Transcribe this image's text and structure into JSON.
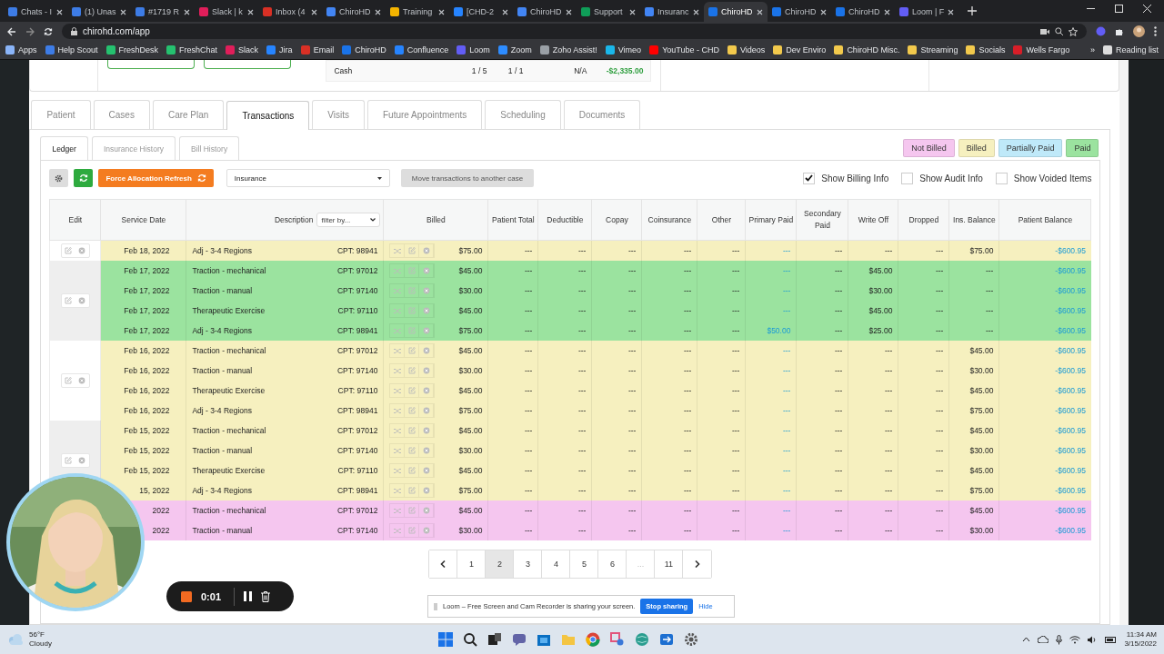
{
  "browser": {
    "tabs": [
      {
        "title": "Chats - I",
        "color": "#3d7ce6",
        "selected": false
      },
      {
        "title": "(1) Unas",
        "color": "#3d7ce6",
        "selected": false
      },
      {
        "title": "#1719 R",
        "color": "#3d7ce6",
        "selected": false
      },
      {
        "title": "Slack | k",
        "color": "#e01e5a",
        "selected": false
      },
      {
        "title": "Inbox (4",
        "color": "#d93025",
        "selected": false
      },
      {
        "title": "ChiroHD",
        "color": "#4285f4",
        "selected": false
      },
      {
        "title": "Training",
        "color": "#f4b400",
        "selected": false
      },
      {
        "title": "[CHD-2",
        "color": "#2684ff",
        "selected": false
      },
      {
        "title": "ChiroHD",
        "color": "#4285f4",
        "selected": false
      },
      {
        "title": "Support",
        "color": "#0f9d58",
        "selected": false
      },
      {
        "title": "Insuranc",
        "color": "#4285f4",
        "selected": false
      },
      {
        "title": "ChiroHD",
        "color": "#1a73e8",
        "selected": true
      },
      {
        "title": "ChiroHD",
        "color": "#1a73e8",
        "selected": false
      },
      {
        "title": "ChiroHD",
        "color": "#1a73e8",
        "selected": false
      },
      {
        "title": "Loom | F",
        "color": "#625df5",
        "selected": false
      }
    ],
    "url": "chirohd.com/app",
    "bookmarks": [
      {
        "label": "Apps",
        "color": "#8ab4f8"
      },
      {
        "label": "Help Scout",
        "color": "#3d7ce6"
      },
      {
        "label": "FreshDesk",
        "color": "#25c16f"
      },
      {
        "label": "FreshChat",
        "color": "#25c16f"
      },
      {
        "label": "Slack",
        "color": "#e01e5a"
      },
      {
        "label": "Jira",
        "color": "#2684ff"
      },
      {
        "label": "Email",
        "color": "#d93025"
      },
      {
        "label": "ChiroHD",
        "color": "#1a73e8"
      },
      {
        "label": "Confluence",
        "color": "#2684ff"
      },
      {
        "label": "Loom",
        "color": "#625df5"
      },
      {
        "label": "Zoom",
        "color": "#2d8cff"
      },
      {
        "label": "Zoho Assist!",
        "color": "#9aa0a6"
      },
      {
        "label": "Vimeo",
        "color": "#1ab7ea"
      },
      {
        "label": "YouTube - CHD",
        "color": "#ff0000"
      },
      {
        "label": "Videos",
        "color": "#f2c94c"
      },
      {
        "label": "Dev Enviro",
        "color": "#f2c94c"
      },
      {
        "label": "ChiroHD Misc.",
        "color": "#f2c94c"
      },
      {
        "label": "Streaming",
        "color": "#f2c94c"
      },
      {
        "label": "Socials",
        "color": "#f2c94c"
      },
      {
        "label": "Wells Fargo",
        "color": "#d71e28"
      }
    ],
    "bookmarks_more": "»",
    "reading_list": "Reading list"
  },
  "summary": {
    "payer": "Cash",
    "column_2": "1 / 5",
    "column_3": "1 / 1",
    "column_4": "N/A",
    "amount": "-$2,335.00"
  },
  "tabs": [
    {
      "label": "Patient",
      "selected": false
    },
    {
      "label": "Cases",
      "selected": false
    },
    {
      "label": "Care Plan",
      "selected": false
    },
    {
      "label": "Transactions",
      "selected": true
    },
    {
      "label": "Visits",
      "selected": false
    },
    {
      "label": "Future Appointments",
      "selected": false
    },
    {
      "label": "Scheduling",
      "selected": false
    },
    {
      "label": "Documents",
      "selected": false
    }
  ],
  "subtabs": [
    {
      "label": "Ledger",
      "selected": true
    },
    {
      "label": "Insurance History",
      "selected": false
    },
    {
      "label": "Bill History",
      "selected": false
    }
  ],
  "legend": [
    {
      "label": "Not Billed",
      "color": "#f5c6ef"
    },
    {
      "label": "Billed",
      "color": "#f6f0bf"
    },
    {
      "label": "Partially Paid",
      "color": "#bfe9f9"
    },
    {
      "label": "Paid",
      "color": "#9be39f"
    }
  ],
  "toolbar": {
    "refresh_button": "Force Allocation Refresh",
    "case_select": "Insurance",
    "move_button": "Move transactions to another case",
    "options": [
      {
        "label": "Show Billing Info",
        "checked": true
      },
      {
        "label": "Show Audit Info",
        "checked": false
      },
      {
        "label": "Show Voided Items",
        "checked": false
      }
    ]
  },
  "table": {
    "columns": [
      "Edit",
      "Service Date",
      "Description",
      "Billed",
      "Patient Total",
      "Deductible",
      "Copay",
      "Coinsurance",
      "Other",
      "Primary Paid",
      "Secondary Paid",
      "Write Off",
      "Dropped",
      "Ins. Balance",
      "Patient Balance"
    ],
    "description_filter": "filter by...",
    "groups": [
      {
        "rows": [
          {
            "color": "#f6f0bf",
            "date": "Feb 18, 2022",
            "description": "Adj - 3-4 Regions",
            "cpt": "CPT: 98941",
            "billed": "$75.00",
            "amounts": [
              "---",
              "---",
              "---",
              "---",
              "---",
              "---",
              "---",
              "---",
              "---",
              "$75.00",
              "-$600.95"
            ]
          }
        ]
      },
      {
        "rows": [
          {
            "color": "#9be39f",
            "date": "Feb 17, 2022",
            "description": "Traction - mechanical",
            "cpt": "CPT: 97012",
            "billed": "$45.00",
            "amounts": [
              "---",
              "---",
              "---",
              "---",
              "---",
              "---",
              "---",
              "$45.00",
              "---",
              "---",
              "-$600.95"
            ]
          },
          {
            "color": "#9be39f",
            "date": "Feb 17, 2022",
            "description": "Traction - manual",
            "cpt": "CPT: 97140",
            "billed": "$30.00",
            "amounts": [
              "---",
              "---",
              "---",
              "---",
              "---",
              "---",
              "---",
              "$30.00",
              "---",
              "---",
              "-$600.95"
            ]
          },
          {
            "color": "#9be39f",
            "date": "Feb 17, 2022",
            "description": "Therapeutic Exercise",
            "cpt": "CPT: 97110",
            "billed": "$45.00",
            "amounts": [
              "---",
              "---",
              "---",
              "---",
              "---",
              "---",
              "---",
              "$45.00",
              "---",
              "---",
              "-$600.95"
            ]
          },
          {
            "color": "#9be39f",
            "date": "Feb 17, 2022",
            "description": "Adj - 3-4 Regions",
            "cpt": "CPT: 98941",
            "billed": "$75.00",
            "amounts": [
              "---",
              "---",
              "---",
              "---",
              "---",
              "$50.00",
              "---",
              "$25.00",
              "---",
              "---",
              "-$600.95"
            ]
          }
        ]
      },
      {
        "rows": [
          {
            "color": "#f6f0bf",
            "date": "Feb 16, 2022",
            "description": "Traction - mechanical",
            "cpt": "CPT: 97012",
            "billed": "$45.00",
            "amounts": [
              "---",
              "---",
              "---",
              "---",
              "---",
              "---",
              "---",
              "---",
              "---",
              "$45.00",
              "-$600.95"
            ]
          },
          {
            "color": "#f6f0bf",
            "date": "Feb 16, 2022",
            "description": "Traction - manual",
            "cpt": "CPT: 97140",
            "billed": "$30.00",
            "amounts": [
              "---",
              "---",
              "---",
              "---",
              "---",
              "---",
              "---",
              "---",
              "---",
              "$30.00",
              "-$600.95"
            ]
          },
          {
            "color": "#f6f0bf",
            "date": "Feb 16, 2022",
            "description": "Therapeutic Exercise",
            "cpt": "CPT: 97110",
            "billed": "$45.00",
            "amounts": [
              "---",
              "---",
              "---",
              "---",
              "---",
              "---",
              "---",
              "---",
              "---",
              "$45.00",
              "-$600.95"
            ]
          },
          {
            "color": "#f6f0bf",
            "date": "Feb 16, 2022",
            "description": "Adj - 3-4 Regions",
            "cpt": "CPT: 98941",
            "billed": "$75.00",
            "amounts": [
              "---",
              "---",
              "---",
              "---",
              "---",
              "---",
              "---",
              "---",
              "---",
              "$75.00",
              "-$600.95"
            ]
          }
        ]
      },
      {
        "rows": [
          {
            "color": "#f6f0bf",
            "date": "Feb 15, 2022",
            "description": "Traction - mechanical",
            "cpt": "CPT: 97012",
            "billed": "$45.00",
            "amounts": [
              "---",
              "---",
              "---",
              "---",
              "---",
              "---",
              "---",
              "---",
              "---",
              "$45.00",
              "-$600.95"
            ]
          },
          {
            "color": "#f6f0bf",
            "date": "Feb 15, 2022",
            "description": "Traction - manual",
            "cpt": "CPT: 97140",
            "billed": "$30.00",
            "amounts": [
              "---",
              "---",
              "---",
              "---",
              "---",
              "---",
              "---",
              "---",
              "---",
              "$30.00",
              "-$600.95"
            ]
          },
          {
            "color": "#f6f0bf",
            "date": "Feb 15, 2022",
            "description": "Therapeutic Exercise",
            "cpt": "CPT: 97110",
            "billed": "$45.00",
            "amounts": [
              "---",
              "---",
              "---",
              "---",
              "---",
              "---",
              "---",
              "---",
              "---",
              "$45.00",
              "-$600.95"
            ]
          },
          {
            "color": "#f6f0bf",
            "date": "15, 2022",
            "description": "Adj - 3-4 Regions",
            "cpt": "CPT: 98941",
            "billed": "$75.00",
            "amounts": [
              "---",
              "---",
              "---",
              "---",
              "---",
              "---",
              "---",
              "---",
              "---",
              "$75.00",
              "-$600.95"
            ]
          }
        ]
      }
    ],
    "covered_group": {
      "rows": [
        {
          "color": "#f5c6ef",
          "date": "2022",
          "description": "Traction - mechanical",
          "cpt": "CPT: 97012",
          "billed": "$45.00",
          "amounts": [
            "---",
            "---",
            "---",
            "---",
            "---",
            "---",
            "---",
            "---",
            "---",
            "$45.00",
            "-$600.95"
          ]
        },
        {
          "color": "#f5c6ef",
          "date": "2022",
          "description": "Traction - manual",
          "cpt": "CPT: 97140",
          "billed": "$30.00",
          "amounts": [
            "---",
            "---",
            "---",
            "---",
            "---",
            "---",
            "---",
            "---",
            "---",
            "$30.00",
            "-$600.95"
          ]
        }
      ]
    }
  },
  "pagination": {
    "pages": [
      {
        "label": "1",
        "selected": false,
        "disabled": false
      },
      {
        "label": "2",
        "selected": true,
        "disabled": false
      },
      {
        "label": "3",
        "selected": false,
        "disabled": false
      },
      {
        "label": "4",
        "selected": false,
        "disabled": false
      },
      {
        "label": "5",
        "selected": false,
        "disabled": false
      },
      {
        "label": "6",
        "selected": false,
        "disabled": false
      },
      {
        "label": "...",
        "selected": false,
        "disabled": true
      },
      {
        "label": "11",
        "selected": false,
        "disabled": false
      }
    ]
  },
  "recorder": {
    "time": "0:01"
  },
  "loom_banner": {
    "message": "Loom – Free Screen and Cam Recorder is sharing your screen.",
    "stop_button": "Stop sharing",
    "hide_link": "Hide"
  },
  "taskbar": {
    "temperature": "56°F",
    "weather": "Cloudy",
    "time": "11:34 AM",
    "date": "3/15/2022"
  }
}
